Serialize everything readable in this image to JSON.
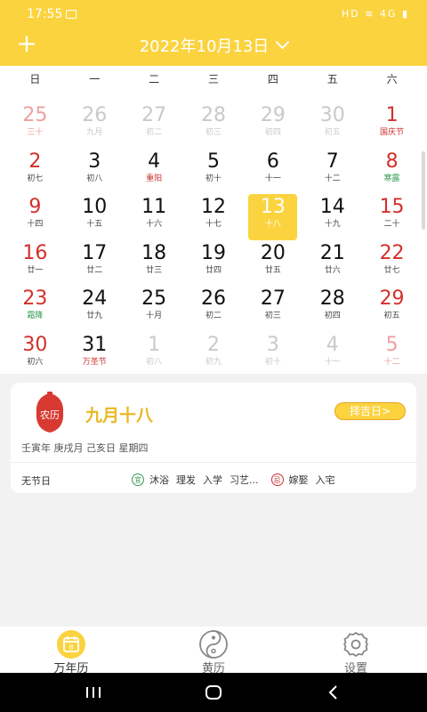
{
  "status": {
    "time": "17:55",
    "sys_icons": "HD ≋ 4G ▮"
  },
  "header": {
    "title": "2022年10月13日",
    "add_symbol": "+"
  },
  "weekdays": [
    "日",
    "一",
    "二",
    "三",
    "四",
    "五",
    "六"
  ],
  "days": [
    {
      "n": "25",
      "l": "三十",
      "dim": true
    },
    {
      "n": "26",
      "l": "九月",
      "dim": true
    },
    {
      "n": "27",
      "l": "初二",
      "dim": true
    },
    {
      "n": "28",
      "l": "初三",
      "dim": true
    },
    {
      "n": "29",
      "l": "初四",
      "dim": true
    },
    {
      "n": "30",
      "l": "初五",
      "dim": true
    },
    {
      "n": "1",
      "l": "国庆节",
      "type": "festival"
    },
    {
      "n": "2",
      "l": "初七"
    },
    {
      "n": "3",
      "l": "初八"
    },
    {
      "n": "4",
      "l": "重阳",
      "type": "festival"
    },
    {
      "n": "5",
      "l": "初十"
    },
    {
      "n": "6",
      "l": "十一"
    },
    {
      "n": "7",
      "l": "十二"
    },
    {
      "n": "8",
      "l": "寒露",
      "type": "term"
    },
    {
      "n": "9",
      "l": "十四"
    },
    {
      "n": "10",
      "l": "十五"
    },
    {
      "n": "11",
      "l": "十六"
    },
    {
      "n": "12",
      "l": "十七"
    },
    {
      "n": "13",
      "l": "十八",
      "selected": true
    },
    {
      "n": "14",
      "l": "十九"
    },
    {
      "n": "15",
      "l": "二十"
    },
    {
      "n": "16",
      "l": "廿一"
    },
    {
      "n": "17",
      "l": "廿二"
    },
    {
      "n": "18",
      "l": "廿三"
    },
    {
      "n": "19",
      "l": "廿四"
    },
    {
      "n": "20",
      "l": "廿五"
    },
    {
      "n": "21",
      "l": "廿六"
    },
    {
      "n": "22",
      "l": "廿七"
    },
    {
      "n": "23",
      "l": "霜降",
      "type": "term"
    },
    {
      "n": "24",
      "l": "廿九"
    },
    {
      "n": "25",
      "l": "十月"
    },
    {
      "n": "26",
      "l": "初二"
    },
    {
      "n": "27",
      "l": "初三"
    },
    {
      "n": "28",
      "l": "初四"
    },
    {
      "n": "29",
      "l": "初五"
    },
    {
      "n": "30",
      "l": "初六"
    },
    {
      "n": "31",
      "l": "万圣节",
      "type": "festival"
    },
    {
      "n": "1",
      "l": "初八",
      "dim": true
    },
    {
      "n": "2",
      "l": "初九",
      "dim": true
    },
    {
      "n": "3",
      "l": "初十",
      "dim": true
    },
    {
      "n": "4",
      "l": "十一",
      "dim": true
    },
    {
      "n": "5",
      "l": "十二",
      "dim": true
    }
  ],
  "card": {
    "seal_text": "农历",
    "lunar_date": "九月十八",
    "pick_day_button": "择吉日>",
    "ganzhi": "壬寅年 庚戌月 己亥日 星期四",
    "festival_text": "无节日",
    "yi_badge": "宜",
    "yi_items": [
      "沐浴",
      "理发",
      "入学",
      "习艺..."
    ],
    "ji_badge": "忌",
    "ji_items": [
      "嫁娶",
      "入宅"
    ]
  },
  "tabs": [
    {
      "label": "万年历",
      "icon": "calendar-icon",
      "icon_text": "8"
    },
    {
      "label": "黄历",
      "icon": "yin-yang-icon"
    },
    {
      "label": "设置",
      "icon": "gear-icon"
    }
  ],
  "colors": {
    "accent": "#fbd33f",
    "weekend_red": "#d2302c",
    "term_green": "#2e9a4f"
  }
}
